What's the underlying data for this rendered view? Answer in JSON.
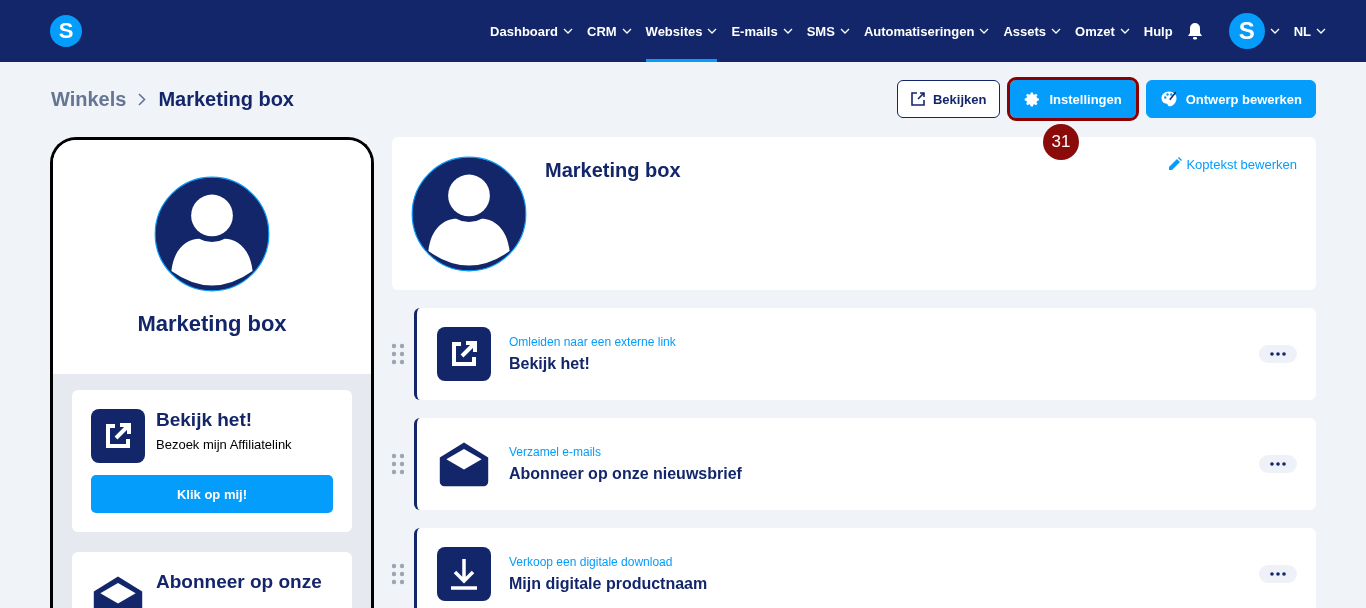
{
  "nav": {
    "logo": "S",
    "items": [
      {
        "label": "Dashboard",
        "dropdown": true,
        "selected": false
      },
      {
        "label": "CRM",
        "dropdown": true,
        "selected": false
      },
      {
        "label": "Websites",
        "dropdown": true,
        "selected": true
      },
      {
        "label": "E-mails",
        "dropdown": true,
        "selected": false
      },
      {
        "label": "SMS",
        "dropdown": true,
        "selected": false
      },
      {
        "label": "Automatiseringen",
        "dropdown": true,
        "selected": false
      },
      {
        "label": "Assets",
        "dropdown": true,
        "selected": false
      },
      {
        "label": "Omzet",
        "dropdown": true,
        "selected": false
      },
      {
        "label": "Hulp",
        "dropdown": false,
        "selected": false
      }
    ],
    "avatar": "S",
    "language": "NL"
  },
  "breadcrumb": [
    "Winkels",
    "Marketing box"
  ],
  "actions": [
    {
      "label": "Bekijken",
      "kind": "outline",
      "highlighted": false
    },
    {
      "label": "Instellingen",
      "kind": "settings",
      "highlighted": true
    },
    {
      "label": "Ontwerp bewerken",
      "kind": "design",
      "highlighted": false
    }
  ],
  "annotation": "31",
  "preview": {
    "title": "Marketing box",
    "cards": [
      {
        "kind": "link",
        "title": "Bekijk het!",
        "subtitle": "Bezoek mijn Affiliatelink",
        "button": "Klik op mij!"
      },
      {
        "kind": "email",
        "title": "Abonneer op onze"
      }
    ]
  },
  "header": {
    "title": "Marketing box",
    "edit_link": "Koptekst bewerken"
  },
  "blocks": [
    {
      "kind": "link",
      "type_label": "Omleiden naar een externe link",
      "title": "Bekijk het!"
    },
    {
      "kind": "email",
      "type_label": "Verzamel e-mails",
      "title": "Abonneer op onze nieuwsbrief"
    },
    {
      "kind": "download",
      "type_label": "Verkoop een digitale download",
      "title": "Mijn digitale productnaam"
    }
  ]
}
